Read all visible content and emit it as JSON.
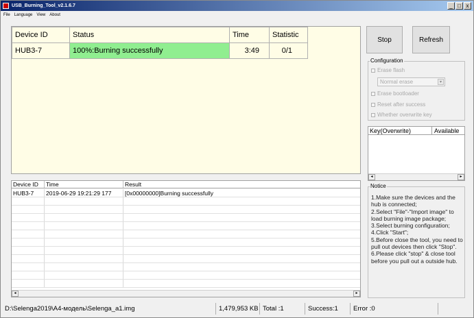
{
  "window": {
    "title": "USB_Burning_Tool_v2.1.6.7",
    "min_label": "_",
    "max_label": "□",
    "close_label": "x"
  },
  "menu": {
    "items": [
      "File",
      "Language",
      "View",
      "About"
    ]
  },
  "device_grid": {
    "headers": [
      "Device ID",
      "Status",
      "Time",
      "Statistic"
    ],
    "rows": [
      {
        "device_id": "HUB3-7",
        "status": "100%:Burning successfully",
        "time": "3:49",
        "statistic": "0/1"
      }
    ],
    "status_ok_color": "#90ee90",
    "background": "#fffde6"
  },
  "buttons": {
    "stop": "Stop",
    "refresh": "Refresh"
  },
  "configuration": {
    "title": "Configuration",
    "erase_flash": "Erase flash",
    "erase_mode": "Normal erase",
    "erase_bootloader": "Erase bootloader",
    "reset_after_success": "Reset after success",
    "overwrite_key": "Whether overwrite key"
  },
  "key_list": {
    "headers": [
      "Key(Overwrite)",
      "Available"
    ]
  },
  "notice": {
    "title": "Notice",
    "lines": [
      "1.Make sure the devices and the hub is connected;",
      "2.Select \"File\"-\"Import image\" to load burning image package;",
      "3.Select burning configuration;",
      "4.Click \"Start\";",
      "5.Before close the tool, you need to pull out devices then click \"Stop\".",
      "6.Please click \"stop\" & close tool before you pull out a outside hub."
    ]
  },
  "log_grid": {
    "headers": [
      "Device ID",
      "Time",
      "Result"
    ],
    "rows": [
      {
        "device_id": "HUB3-7",
        "time": "2019-06-29 19:21:29 177",
        "result": "[0x00000000]Burning successfully"
      }
    ]
  },
  "status_bar": {
    "image_path": "D:\\Selenga2019\\A4-модель\\Selenga_a1.img",
    "image_size": "1,479,953 KB",
    "total": "Total :1",
    "success": "Success:1",
    "error": "Error :0"
  },
  "icons": {
    "app": "app-icon",
    "scroll_left": "◂",
    "scroll_right": "▸",
    "combo_arrow": "▾"
  }
}
